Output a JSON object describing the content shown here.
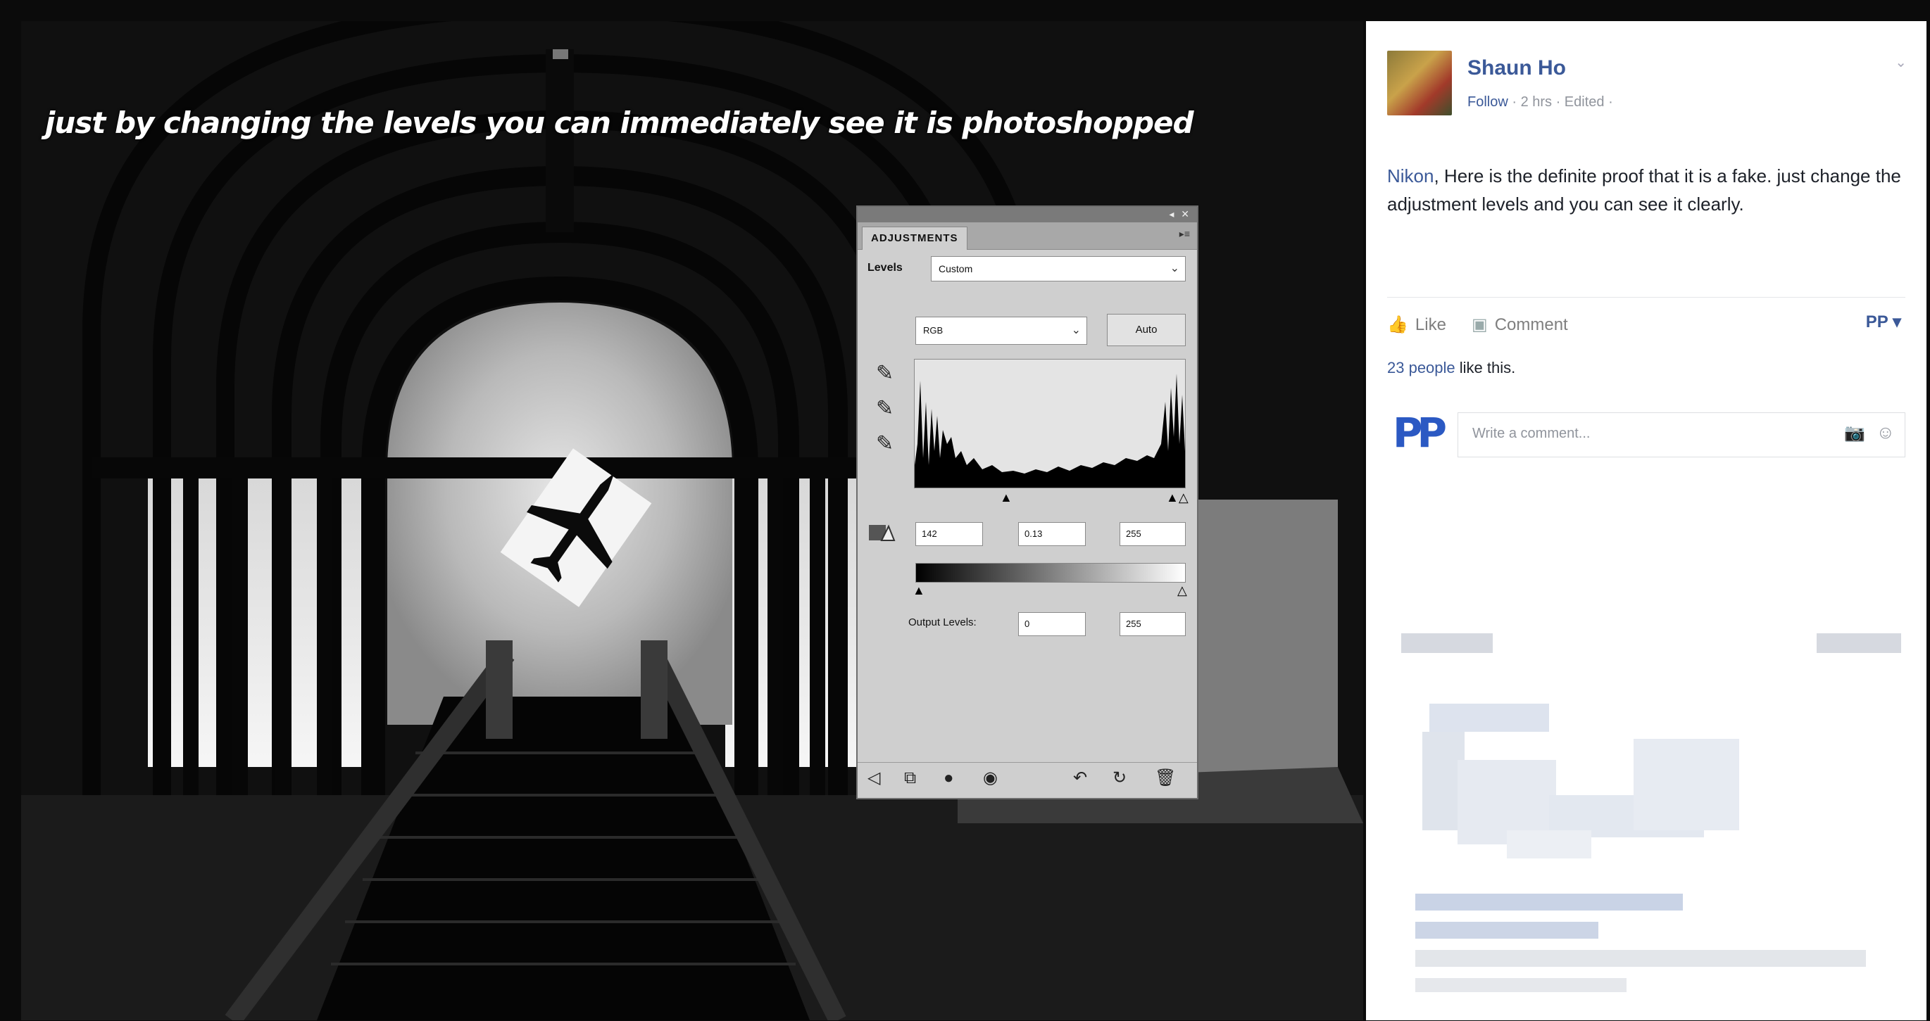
{
  "photo": {
    "caption": "just by changing the levels you can immediately see it is photoshopped"
  },
  "adjustments_panel": {
    "tab_label": "ADJUSTMENTS",
    "levels_label": "Levels",
    "preset_value": "Custom",
    "channel_value": "RGB",
    "auto_label": "Auto",
    "input_black": "142",
    "input_gamma": "0.13",
    "input_white": "255",
    "output_label": "Output Levels:",
    "output_black": "0",
    "output_white": "255"
  },
  "facebook_post": {
    "author": "Shaun Ho",
    "follow_label": "Follow",
    "meta_rest": " · 2 hrs · Edited ·",
    "mention": "Nikon",
    "text_rest": ", Here is the definite proof that it is a fake. just change the adjustment levels and you can see it clearly.",
    "like_label": "Like",
    "comment_label": "Comment",
    "page_initials": "PP ▾",
    "likes_link": "23 people",
    "likes_rest": " like this.",
    "commenter_logo": "PP",
    "comment_placeholder": "Write a comment...",
    "accent_color": "#3b5998"
  }
}
